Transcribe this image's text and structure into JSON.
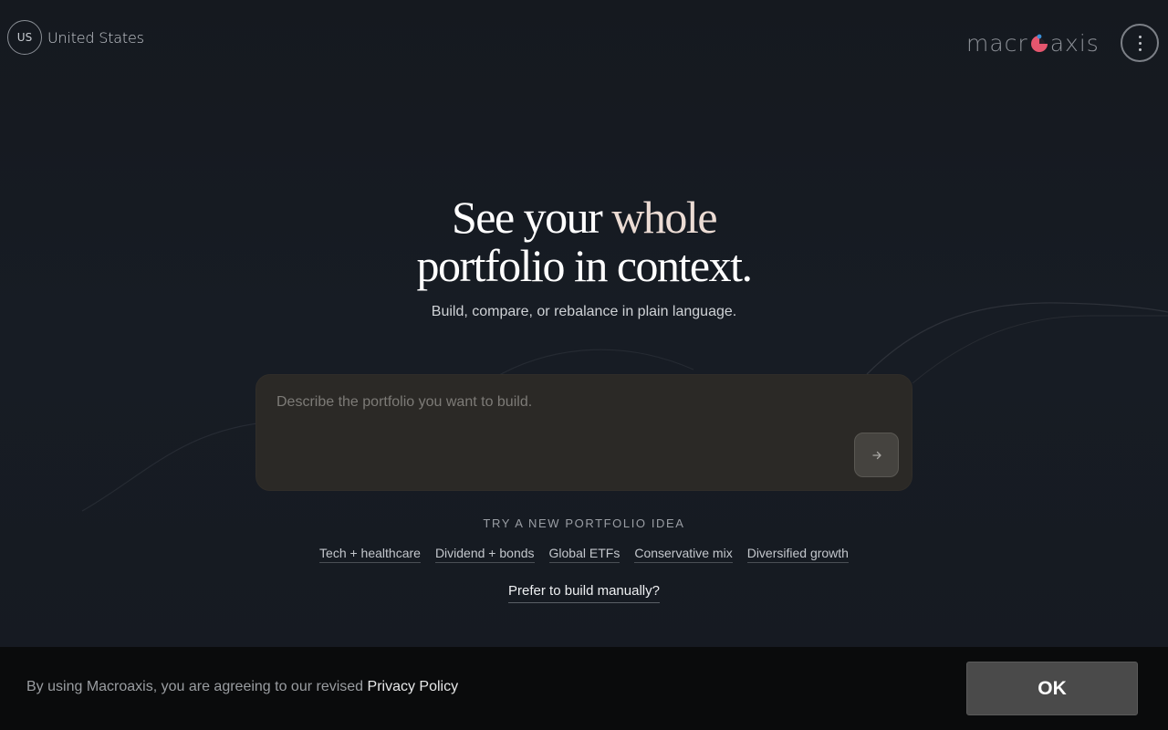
{
  "header": {
    "region_code": "US",
    "region_label": "United States",
    "logo_left": "macr",
    "logo_right": "axis",
    "logo_colors": {
      "red": "#e5566e",
      "blue": "#3a8fd6"
    }
  },
  "hero": {
    "title_part1": "See your ",
    "title_accent": "whole",
    "title_part2": "portfolio in context.",
    "subtitle": "Build, compare, or rebalance in plain language."
  },
  "prompt": {
    "placeholder": "Describe the portfolio you want to build.",
    "value": "",
    "send_icon": "arrow-right-icon"
  },
  "ideas": {
    "heading": "TRY A NEW PORTFOLIO IDEA",
    "items": [
      {
        "label": "Tech + healthcare"
      },
      {
        "label": "Dividend + bonds"
      },
      {
        "label": "Global ETFs"
      },
      {
        "label": "Conservative mix"
      },
      {
        "label": "Diversified growth"
      }
    ]
  },
  "manual_link": "Prefer to build manually?",
  "cookie": {
    "text": "By using Macroaxis, you are agreeing to our revised ",
    "link": "Privacy Policy",
    "ok_label": "OK"
  }
}
